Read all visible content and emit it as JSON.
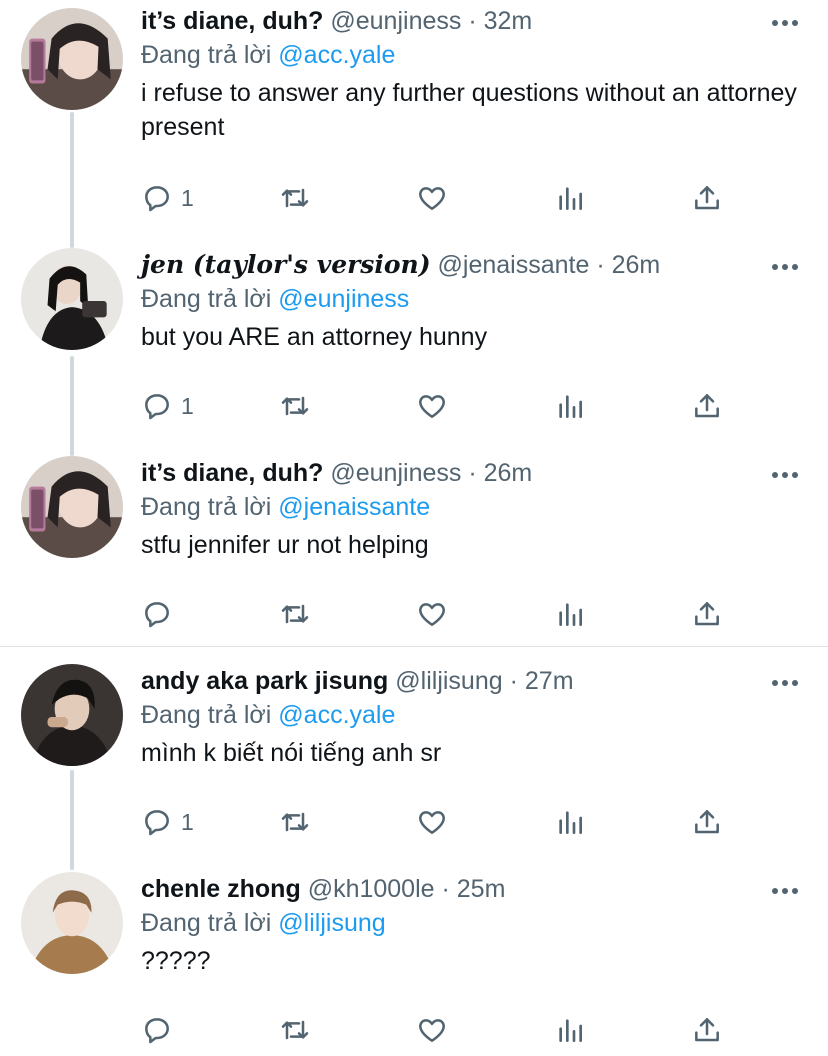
{
  "tweets": [
    {
      "name": "it’s diane, duh?",
      "handle": "@eunjiness",
      "dot": "·",
      "time": "32m",
      "reply_prefix": "Đang trả lời",
      "reply_to": "@acc.yale",
      "text": "i refuse to answer any further questions without an attorney present",
      "reply_count": "1"
    },
    {
      "name": "jen (taylor's version)",
      "handle": "@jenaissante",
      "dot": "·",
      "time": "26m",
      "reply_prefix": "Đang trả lời",
      "reply_to": "@eunjiness",
      "text": "but you ARE an attorney hunny",
      "reply_count": "1"
    },
    {
      "name": "it’s diane, duh?",
      "handle": "@eunjiness",
      "dot": "·",
      "time": "26m",
      "reply_prefix": "Đang trả lời",
      "reply_to": "@jenaissante",
      "text": "stfu jennifer ur not helping",
      "reply_count": ""
    },
    {
      "name": "andy aka park jisung",
      "handle": "@liljisung",
      "dot": "·",
      "time": "27m",
      "reply_prefix": "Đang trả lời",
      "reply_to": "@acc.yale",
      "text": "mình k biết nói tiếng anh sr",
      "reply_count": "1"
    },
    {
      "name": "chenle zhong",
      "handle": "@kh1000le",
      "dot": "·",
      "time": "25m",
      "reply_prefix": "Đang trả lời",
      "reply_to": "@liljisung",
      "text": "?????",
      "reply_count": ""
    }
  ],
  "icons": {
    "more": "more-horizontal-icon",
    "reply": "reply-icon",
    "retweet": "retweet-icon",
    "like": "heart-icon",
    "analytics": "analytics-icon",
    "share": "share-icon"
  },
  "colors": {
    "text": "#0f1419",
    "secondary": "#536471",
    "link": "#1d9bf0",
    "thread_line": "#cfd9de"
  }
}
